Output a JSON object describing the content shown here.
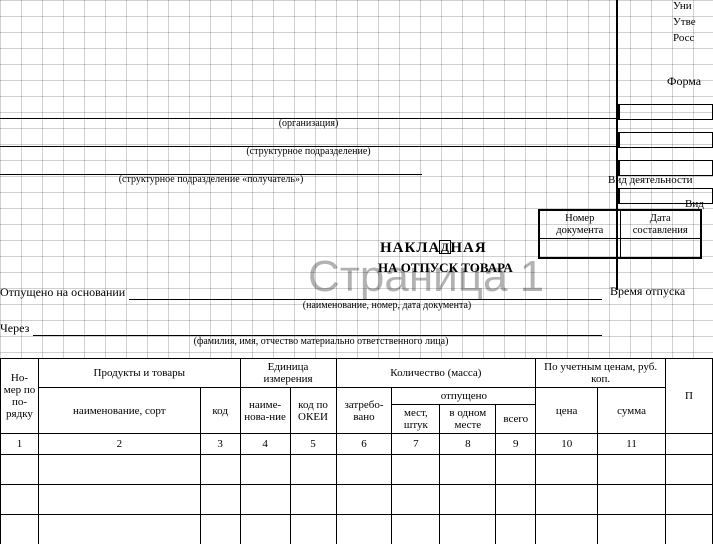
{
  "topmeta": {
    "l1": "Уни",
    "l2": "Утве",
    "l3": "Росс"
  },
  "forma_label": "Форма",
  "captions": {
    "organization": "(организация)",
    "subdivision": "(структурное подразделение)",
    "recipient": "(структурное подразделение «получатель»)",
    "basis": "(наименование, номер, дата документа)",
    "through": "(фамилия, имя, отчество материально ответственного лица)"
  },
  "labels": {
    "activity_kind": "Вид деятельности",
    "kind": "Вид",
    "doc_number": "Номер документа",
    "doc_date": "Дата составления",
    "title_main_pre": "НАКЛА",
    "title_cursor": "Д",
    "title_main_post": "НАЯ",
    "title_sub": "НА ОТПУСК ТОВАРА",
    "basis": "Отпущено на основании",
    "through": "Через",
    "time_release": "Время отпуска"
  },
  "watermark": "Страница 1",
  "table": {
    "head": {
      "col_no": "Но-мер по по-рядку",
      "products": "Продукты и товары",
      "unit": "Единица измерения",
      "qty": "Количество (масса)",
      "price_group": "По учетным ценам, руб. коп.",
      "name_sort": "наименование, сорт",
      "code": "код",
      "unit_name": "наиме-нова-ние",
      "okei": "код по ОКЕИ",
      "requested": "затребо-вано",
      "released": "отпущено",
      "places": "мест, штук",
      "per_place": "в одном месте",
      "total": "всего",
      "price": "цена",
      "sum": "сумма",
      "price_group2": "П"
    },
    "numbers": [
      "1",
      "2",
      "3",
      "4",
      "5",
      "6",
      "7",
      "8",
      "9",
      "10",
      "11",
      ""
    ],
    "rows": [
      {
        "n": "",
        "name": "",
        "code": "",
        "unit_name": "",
        "okei": "",
        "req": "",
        "places": "",
        "per": "",
        "total": "",
        "price": "",
        "sum": "",
        "p2": ""
      },
      {
        "n": "",
        "name": "",
        "code": "",
        "unit_name": "",
        "okei": "",
        "req": "",
        "places": "",
        "per": "",
        "total": "",
        "price": "",
        "sum": "",
        "p2": ""
      },
      {
        "n": "",
        "name": "",
        "code": "",
        "unit_name": "",
        "okei": "",
        "req": "",
        "places": "",
        "per": "",
        "total": "",
        "price": "",
        "sum": "",
        "p2": ""
      }
    ]
  }
}
